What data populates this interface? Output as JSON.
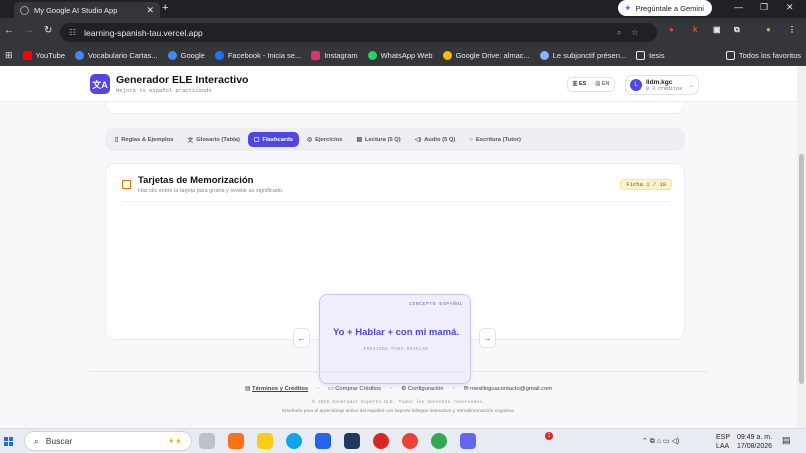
{
  "browser": {
    "tab_title": "My Google AI Studio App",
    "gemini_label": "Pregúntale a Gemini",
    "url": "learning-spanish-tau.vercel.app",
    "bookmarks": [
      "YouTube",
      "Vocabulario Cartas...",
      "Google",
      "Facebook - Inicia se...",
      "Instagram",
      "WhatsApp Web",
      "Google Drive: almac...",
      "Le subjonctif présen...",
      "tesis"
    ],
    "bookmark_colors": [
      "#ff0000",
      "#4285f4",
      "#4285f4",
      "#1877f2",
      "#e1306c",
      "#25d366",
      "#fbbc04",
      "#8ab4f8",
      "#e8eaed"
    ],
    "all_bookmarks": "Todos los favoritos"
  },
  "app": {
    "title": "Generador ELE Interactivo",
    "subtitle": "Mejora tu español practicando",
    "lang_es": "ES",
    "lang_en": "EN",
    "user_initial": "L",
    "user_name": "lldm.kgc",
    "user_credits": "0 3 créditos",
    "accent_color": "#4f46e5"
  },
  "tabs": [
    {
      "label": "Reglas & Ejemplos",
      "icon": "book-icon",
      "active": false
    },
    {
      "label": "Glosario (Tabla)",
      "icon": "translate-icon",
      "active": false
    },
    {
      "label": "Flashcards",
      "icon": "card-icon",
      "active": true
    },
    {
      "label": "Ejercicios",
      "icon": "check-circle-icon",
      "active": false
    },
    {
      "label": "Lectura (5 Q)",
      "icon": "document-icon",
      "active": false
    },
    {
      "label": "Audio (5 Q)",
      "icon": "speaker-icon",
      "active": false
    },
    {
      "label": "Escritura (Tutor)",
      "icon": "chat-icon",
      "active": false
    }
  ],
  "flashcards": {
    "title": "Tarjetas de Memorización",
    "subtitle": "Haz clic sobre la tarjeta para girarla y revelar su significado.",
    "counter": "Ficha 1 / 10",
    "concept_label": "CONCEPTO ESPAÑOL",
    "card_text": "Yo + Hablar + con mi mamá.",
    "press_label": "PRESIONA PARA REVELAR",
    "prev": "←",
    "next": "→"
  },
  "footer": {
    "terms": "Términos y Créditos",
    "buy": "Comprar Créditos",
    "config": "Configuración",
    "email": "mexilinguacontacto@gmail.com",
    "copyright": "© 2026 Generador Experto ELE. Todos los derechos reservados.",
    "tagline": "Diseñado para el aprendizaje activo del español con soporte bilingüe interactivo y retroalimentación cognitiva."
  },
  "taskbar": {
    "search": "Buscar",
    "lang": "ESP",
    "layout": "LAA",
    "time": "09:49 a. m.",
    "date": "17/08/2026",
    "badge": "1"
  }
}
